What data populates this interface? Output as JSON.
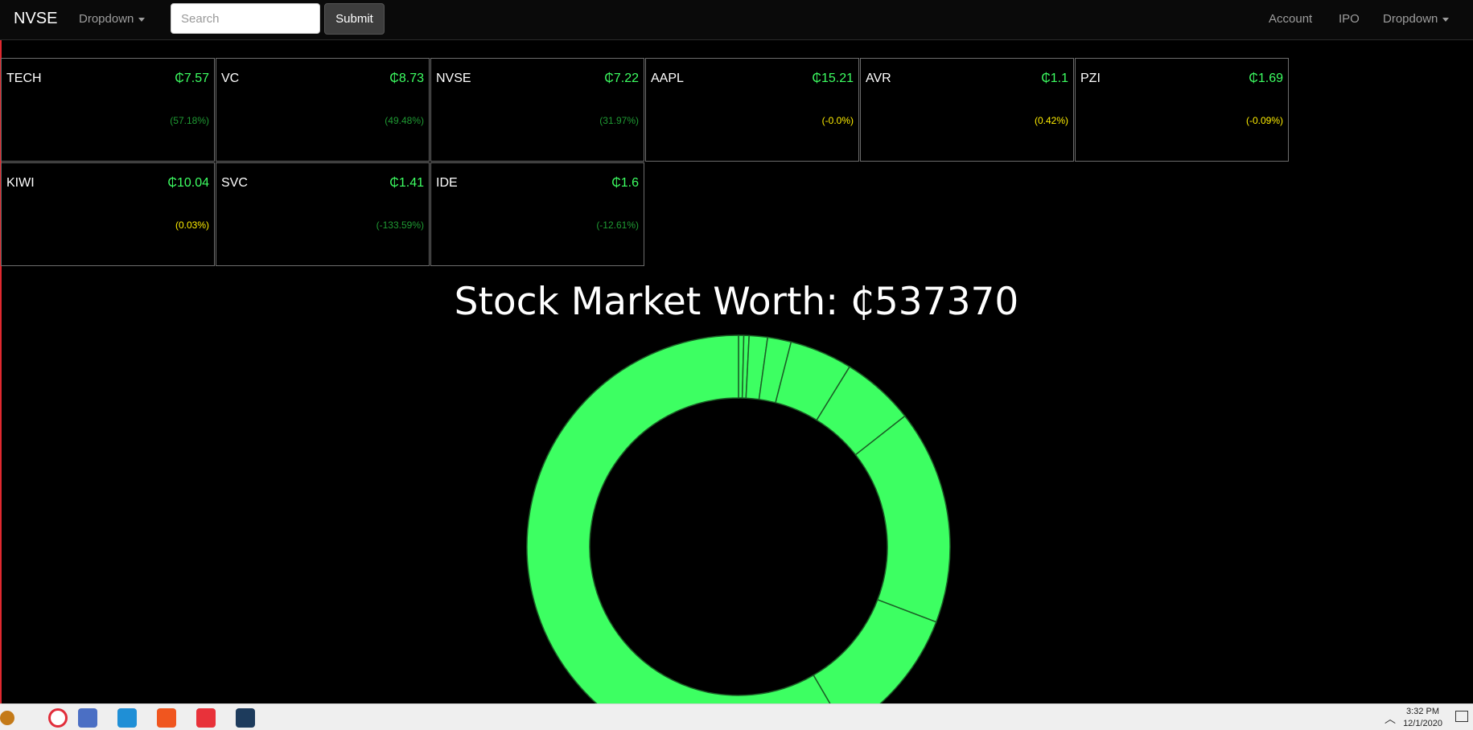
{
  "navbar": {
    "brand": "NVSE",
    "left_dropdown": "Dropdown",
    "search": {
      "placeholder": "Search",
      "value": ""
    },
    "submit_label": "Submit",
    "account": "Account",
    "ipo": "IPO",
    "right_dropdown": "Dropdown"
  },
  "colors": {
    "up_price": "#3dff62",
    "change_green": "#1f9a33",
    "change_yellow": "#ffee00",
    "donut_fill": "#3dff62",
    "background": "#000000"
  },
  "stocks": [
    {
      "symbol": "TECH",
      "price": "₵7.57",
      "change": "(57.18%)",
      "change_color": "green"
    },
    {
      "symbol": "VC",
      "price": "₵8.73",
      "change": "(49.48%)",
      "change_color": "green"
    },
    {
      "symbol": "NVSE",
      "price": "₵7.22",
      "change": "(31.97%)",
      "change_color": "green"
    },
    {
      "symbol": "AAPL",
      "price": "₵15.21",
      "change": "(-0.0%)",
      "change_color": "yellow"
    },
    {
      "symbol": "AVR",
      "price": "₵1.1",
      "change": "(0.42%)",
      "change_color": "yellow"
    },
    {
      "symbol": "PZI",
      "price": "₵1.69",
      "change": "(-0.09%)",
      "change_color": "yellow"
    },
    {
      "symbol": "KIWI",
      "price": "₵10.04",
      "change": "(0.03%)",
      "change_color": "yellow"
    },
    {
      "symbol": "SVC",
      "price": "₵1.41",
      "change": "(-133.59%)",
      "change_color": "green"
    },
    {
      "symbol": "IDE",
      "price": "₵1.6",
      "change": "(-12.61%)",
      "change_color": "green"
    }
  ],
  "market": {
    "worth_label": "Stock Market Worth: ₵537370"
  },
  "chart_data": {
    "type": "pie",
    "variant": "donut",
    "slices_percent": [
      0.4,
      0.4,
      1.4,
      1.8,
      4.8,
      5.6,
      16.4,
      10.8,
      58.4
    ]
  },
  "taskbar": {
    "time": "3:32 PM",
    "date": "12/1/2020",
    "apps": [
      "cloud-app-icon",
      "opera-icon",
      "games-icon",
      "edge-icon",
      "brave-icon",
      "lightning-app-icon",
      "hexagon-app-icon"
    ]
  }
}
